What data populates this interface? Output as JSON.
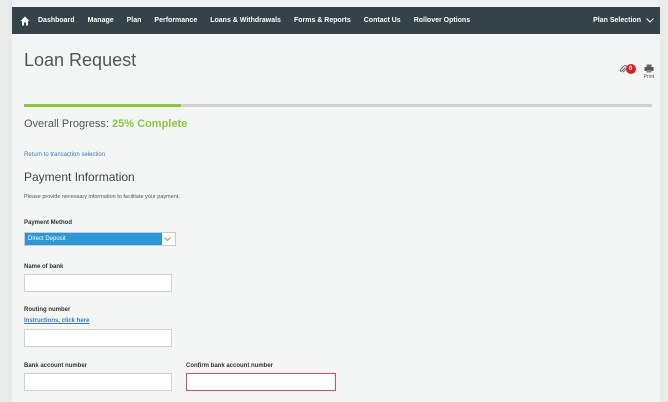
{
  "nav": {
    "items": [
      "Dashboard",
      "Manage",
      "Plan",
      "Performance",
      "Loans & Withdrawals",
      "Forms & Reports",
      "Contact Us",
      "Rollover Options"
    ],
    "plan_selection": "Plan Selection"
  },
  "page": {
    "title": "Loan Request",
    "badge_count": "0",
    "print_label": "Print"
  },
  "progress": {
    "label": "Overall Progress:",
    "value_text": "25% Complete",
    "fraction": 0.25
  },
  "back_link": "Return to transaction selection",
  "section": {
    "title": "Payment Information",
    "description": "Please provide necessary information to facilitate your payment."
  },
  "form": {
    "payment_method_label": "Payment Method",
    "payment_method_value": "Direct Deposit",
    "bank_name_label": "Name of bank",
    "routing_label": "Routing number",
    "routing_help": "Instructions, click here",
    "account_label": "Bank account number",
    "confirm_account_label": "Confirm bank account number"
  },
  "colors": {
    "nav_bg": "#34424a",
    "progress": "#8cc63f",
    "select": "#2b96d6",
    "badge": "#d9202a",
    "error_border": "#d9505a"
  }
}
